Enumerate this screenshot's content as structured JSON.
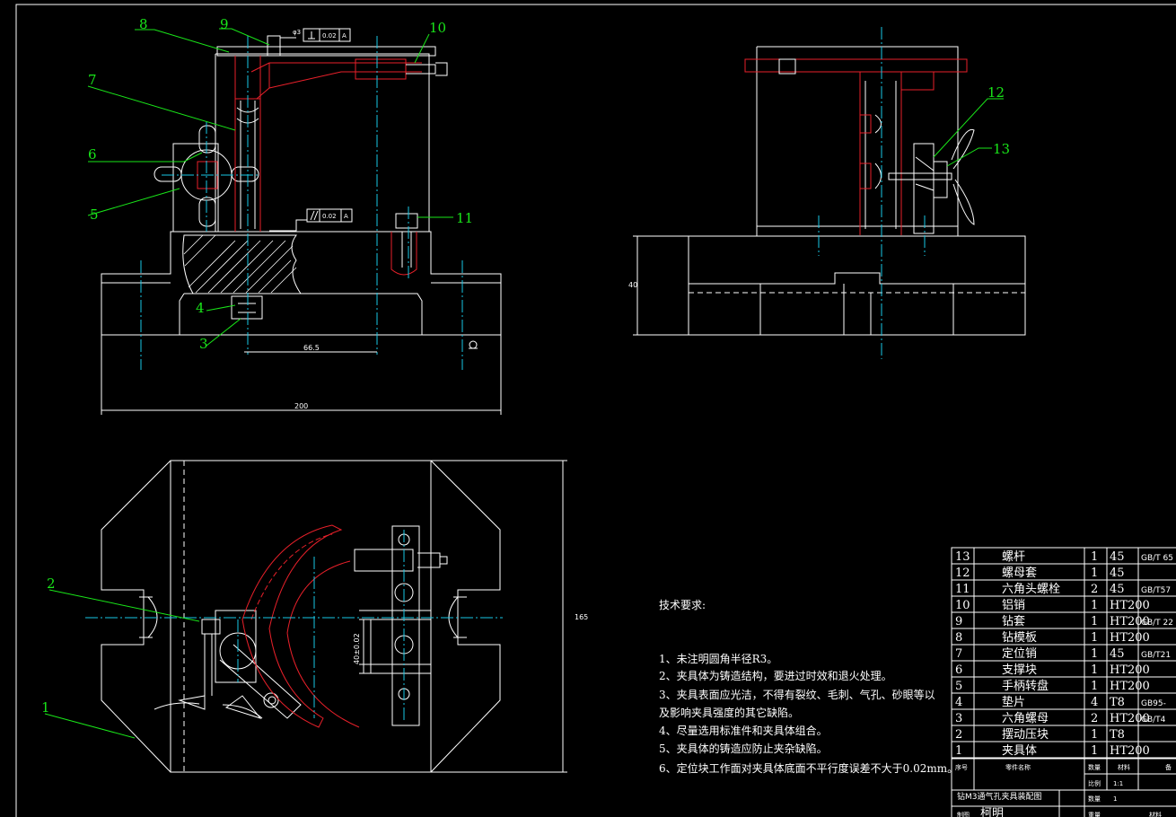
{
  "callouts": [
    "1",
    "2",
    "3",
    "4",
    "5",
    "6",
    "7",
    "8",
    "9",
    "10",
    "11",
    "12",
    "13"
  ],
  "dimensions": {
    "width_total": "200",
    "offset": "66.5",
    "height_right": "40",
    "plan_height": "165",
    "plan_inner": "40±0.02"
  },
  "tolerances": {
    "perp_diam": "φ3",
    "perp_value": "0.02",
    "perp_datum": "A",
    "par_value": "0.02",
    "par_datum": "A"
  },
  "tech": {
    "title": "技术要求:",
    "items": [
      "1、未注明圆角半径R3。",
      "2、夹具体为铸造结构，要进过时效和退火处理。",
      "3、夹具表面应光洁，不得有裂纹、毛刺、气孔、砂眼等以",
      "及影响夹具强度的其它缺陷。",
      "4、尽量选用标准件和夹具体组合。",
      "5、夹具体的铸造应防止夹杂缺陷。",
      "6、定位块工作面对夹具体底面不平行度误差不大于0.02mm。"
    ]
  },
  "bom": {
    "rows": [
      {
        "no": "13",
        "name": "螺杆",
        "qty": "1",
        "mat": "45",
        "std": "GB/T 65"
      },
      {
        "no": "12",
        "name": "螺母套",
        "qty": "1",
        "mat": "45",
        "std": ""
      },
      {
        "no": "11",
        "name": "六角头螺栓",
        "qty": "2",
        "mat": "45",
        "std": "GB/T57"
      },
      {
        "no": "10",
        "name": "铝销",
        "qty": "1",
        "mat": "HT200",
        "std": ""
      },
      {
        "no": "9",
        "name": "钻套",
        "qty": "1",
        "mat": "HT200",
        "std": "GB/T 22"
      },
      {
        "no": "8",
        "name": "钻模板",
        "qty": "1",
        "mat": "HT200",
        "std": ""
      },
      {
        "no": "7",
        "name": "定位销",
        "qty": "1",
        "mat": "45",
        "std": "GB/T21"
      },
      {
        "no": "6",
        "name": "支撑块",
        "qty": "1",
        "mat": "HT200",
        "std": ""
      },
      {
        "no": "5",
        "name": "手柄转盘",
        "qty": "1",
        "mat": "HT200",
        "std": ""
      },
      {
        "no": "4",
        "name": "垫片",
        "qty": "4",
        "mat": "T8",
        "std": "GB95-"
      },
      {
        "no": "3",
        "name": "六角螺母",
        "qty": "2",
        "mat": "HT200",
        "std": "GB/T4"
      },
      {
        "no": "2",
        "name": "摆动压块",
        "qty": "1",
        "mat": "T8",
        "std": ""
      },
      {
        "no": "1",
        "name": "夹具体",
        "qty": "1",
        "mat": "HT200",
        "std": ""
      }
    ],
    "header": {
      "no": "序号",
      "name": "零件名称",
      "qty": "数量",
      "mat": "材料",
      "note": "备"
    },
    "title": "钻M3通气孔夹具装配图",
    "scale_label": "比例",
    "scale_value": "1:1",
    "count_label": "数量",
    "count_value": "1",
    "drawn_label": "制图",
    "drawn_value": "柯明",
    "weight_label": "重量",
    "material_label": "材料"
  },
  "colors": {
    "outline": "#ffffff",
    "hidden_red": "#e8202a",
    "leader_green": "#19e619",
    "centerline_cyan": "#19c8e6"
  }
}
